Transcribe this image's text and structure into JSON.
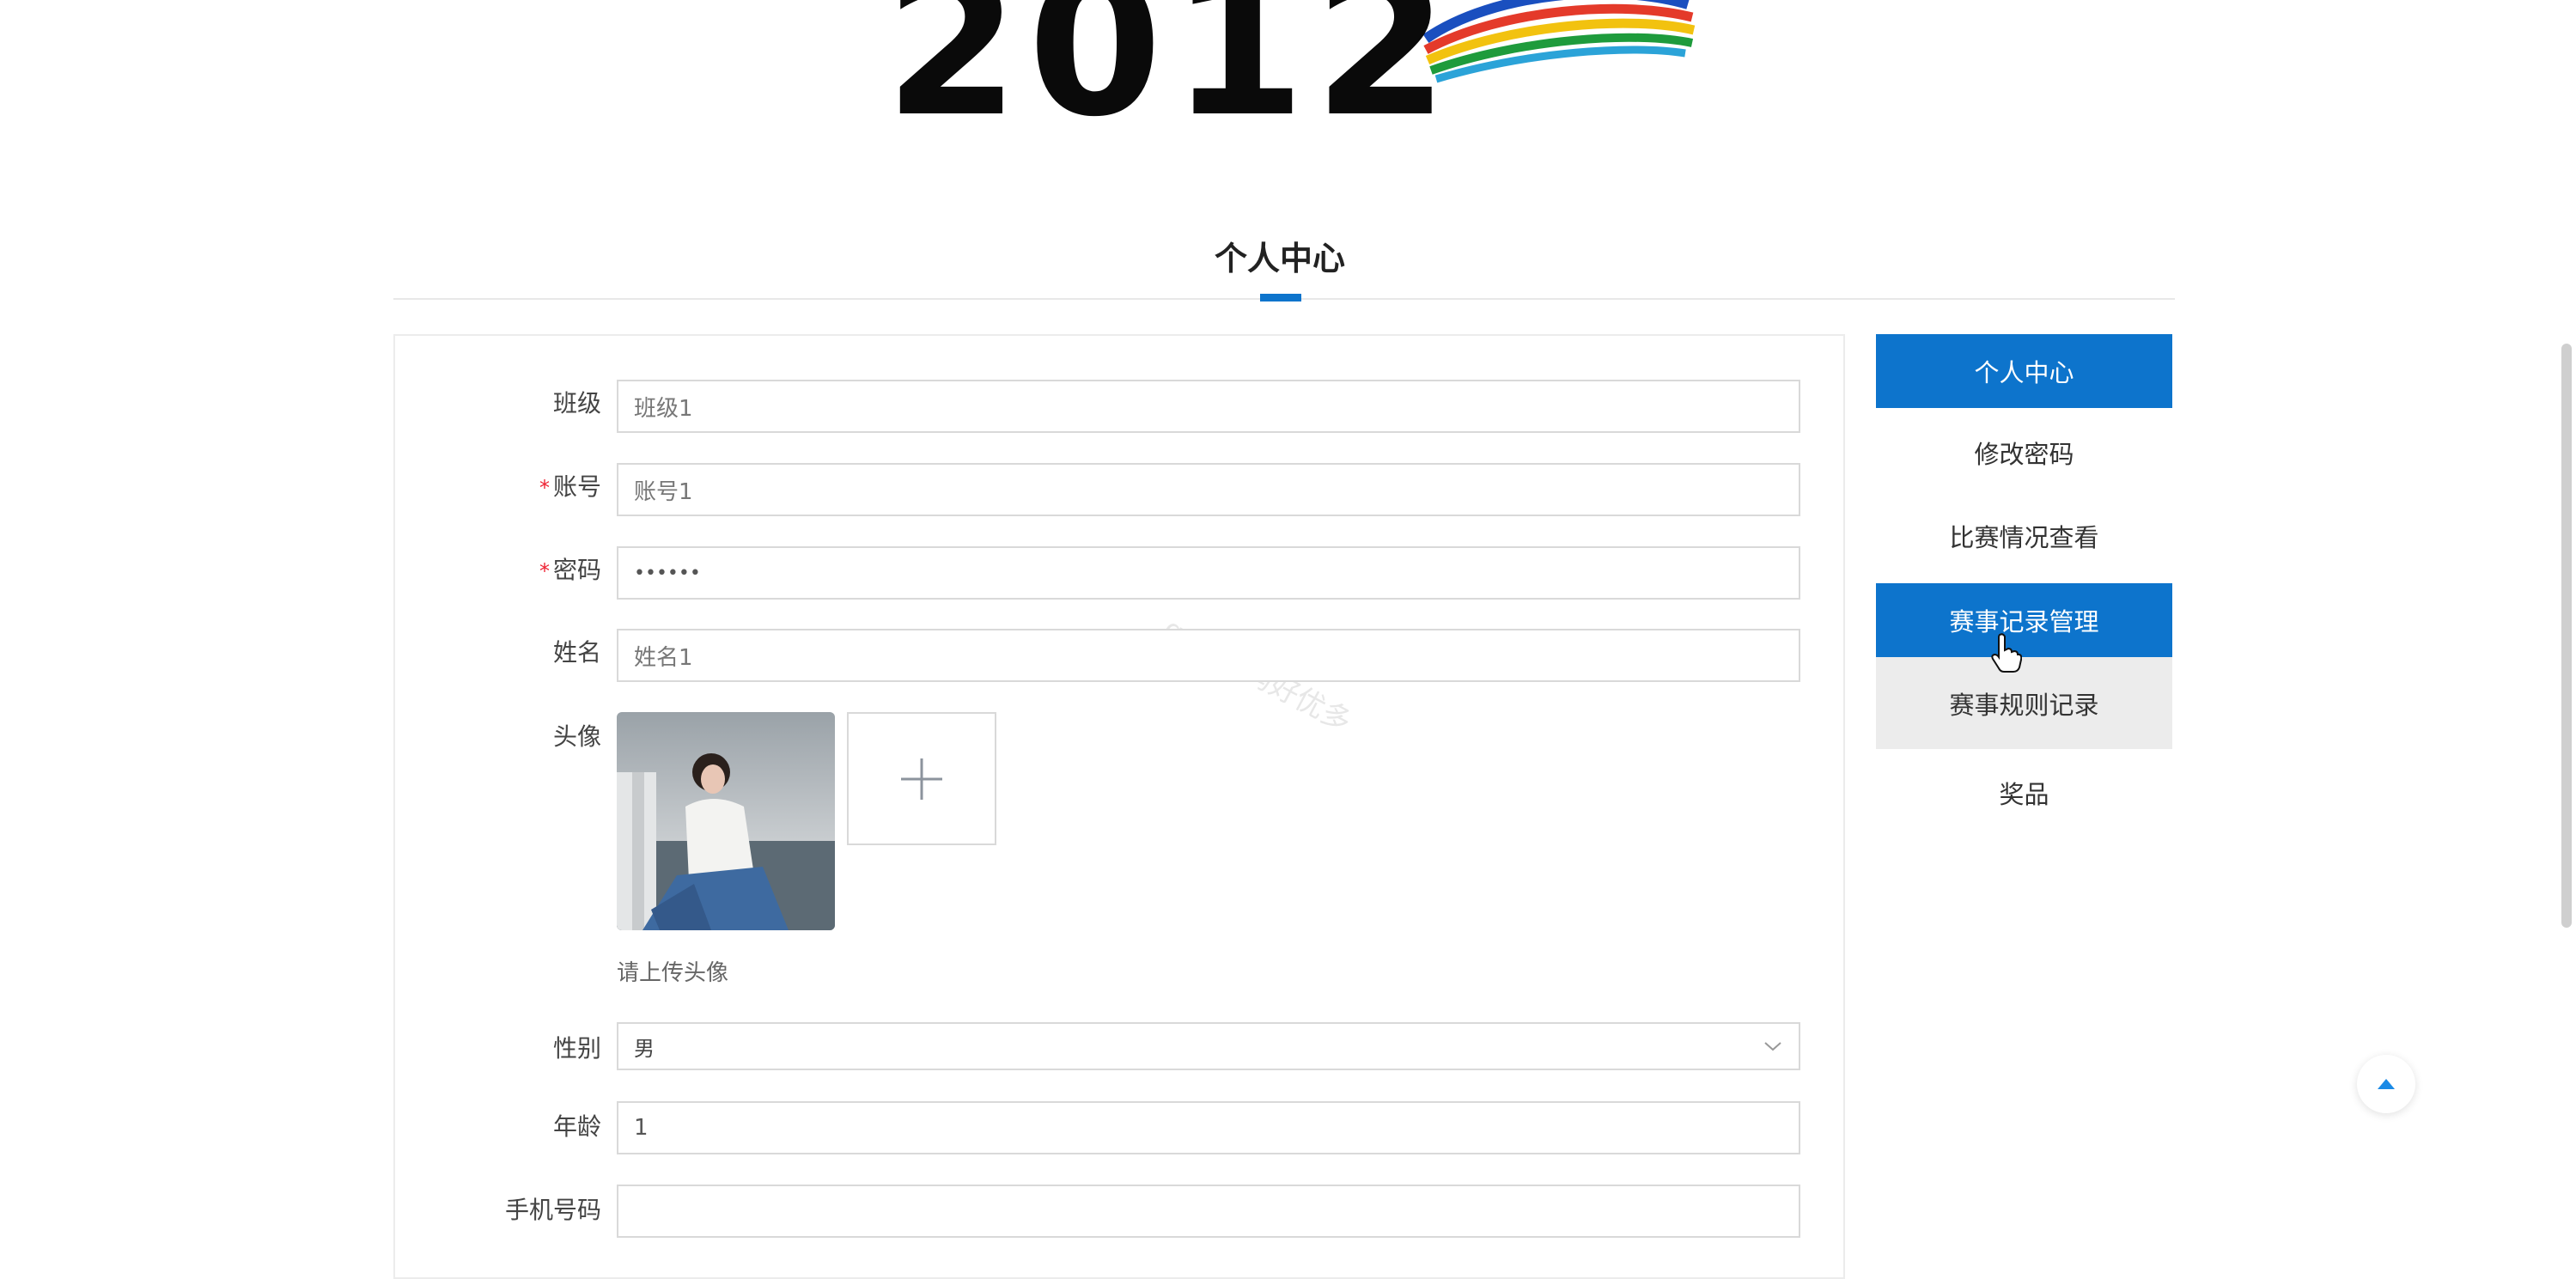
{
  "banner": {
    "logo_text": "2012"
  },
  "page": {
    "section_title": "个人中心",
    "watermark": "gzh 源码好优多"
  },
  "form": {
    "class_label": "班级",
    "class_value": "班级1",
    "account_label": "账号",
    "account_value": "账号1",
    "password_label": "密码",
    "password_value": "••••••",
    "name_label": "姓名",
    "name_value": "姓名1",
    "avatar_label": "头像",
    "avatar_hint": "请上传头像",
    "gender_label": "性别",
    "gender_value": "男",
    "age_label": "年龄",
    "age_value": "1",
    "phone_label": "手机号码",
    "phone_value": "",
    "required_mark": "*"
  },
  "menu": {
    "items": [
      {
        "label": "个人中心",
        "state": "active"
      },
      {
        "label": "修改密码",
        "state": "normal"
      },
      {
        "label": "比赛情况查看",
        "state": "normal"
      },
      {
        "label": "赛事记录管理",
        "state": "active"
      },
      {
        "label": "赛事规则记录",
        "state": "hovered"
      },
      {
        "label": "奖品",
        "state": "normal"
      }
    ]
  },
  "colors": {
    "accent": "#0d74cc",
    "required": "#ee2233",
    "hover_bg": "#ececec"
  },
  "icons": {
    "add": "plus-icon",
    "select": "chevron-down-icon",
    "back_to_top": "arrow-up-icon",
    "cursor": "hand-pointer-icon"
  }
}
